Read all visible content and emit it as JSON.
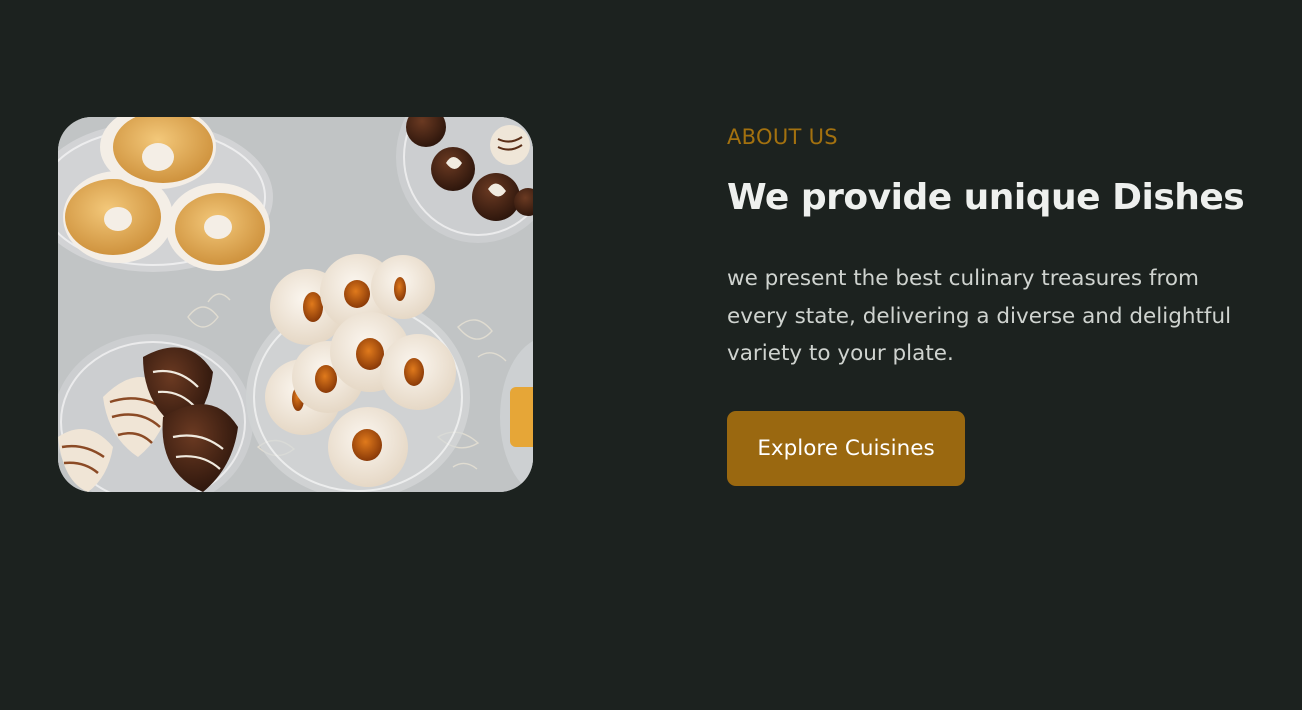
{
  "about": {
    "eyebrow": "ABOUT US",
    "heading": "We provide unique Dishes",
    "description": "we present the best culinary treasures from every state, delivering a diverse and delightful variety to your plate.",
    "cta_label": "Explore Cuisines"
  },
  "colors": {
    "background": "#1c221f",
    "accent": "#a3710f",
    "button": "#9a6810",
    "heading": "#eef0ee",
    "body_text": "#cfd3cf"
  },
  "image": {
    "subject": "plates of cookies and chocolates on a lace tablecloth"
  }
}
